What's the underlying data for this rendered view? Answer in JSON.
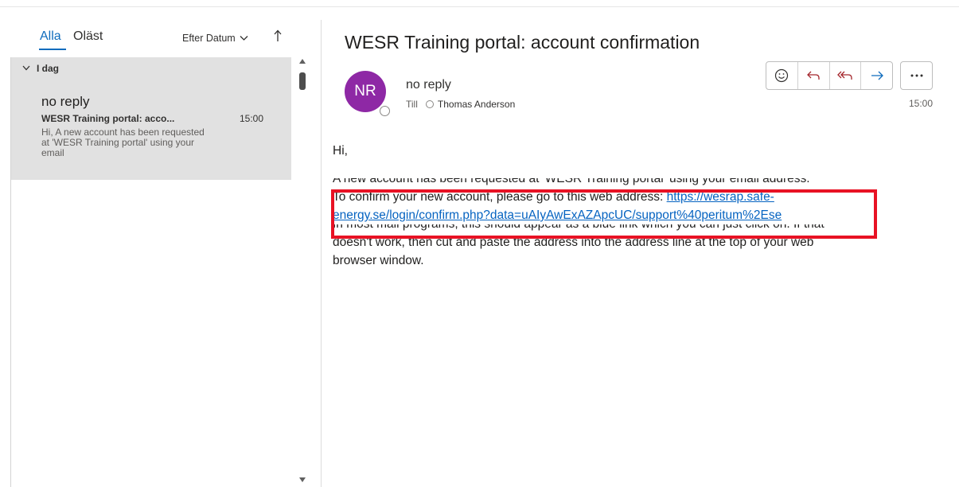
{
  "message_list": {
    "tabs": [
      {
        "label": "Alla",
        "active": true
      },
      {
        "label": "Oläst",
        "active": false
      }
    ],
    "sort_label": "Efter Datum",
    "group_label": "I dag",
    "messages": [
      {
        "sender": "no reply",
        "subject": "WESR Training portal: acco...",
        "time": "15:00",
        "preview": "Hi,  A new account has been requested at 'WESR Training portal' using your email"
      }
    ]
  },
  "reading_pane": {
    "subject": "WESR Training portal: account confirmation",
    "avatar_initials": "NR",
    "avatar_color": "#8e28a5",
    "from": "no reply",
    "to_label": "Till",
    "recipient": "Thomas Anderson",
    "time": "15:00",
    "actions": [
      "emoji-icon",
      "reply-icon",
      "reply-all-icon",
      "forward-icon",
      "more-icon"
    ],
    "body": {
      "greeting": "Hi,",
      "line1": "A new account has been requested at 'WESR Training portal' using your email address.",
      "line2_prefix": "To confirm your new account, please go to this web address: ",
      "link_part1": "https://wesrap.safe-",
      "link_part2": "energy.se/login/confirm.php?data=uAIyAwExAZApcUC/support%40peritum%2Ese",
      "line4": "In most mail programs, this should appear as a blue link which you can just click on. If that",
      "line5": "doesn't work, then cut and paste the address into the address line at the top of your web",
      "line6": "browser window."
    },
    "highlight_color": "#e81224",
    "link_color": "#0563c1"
  }
}
